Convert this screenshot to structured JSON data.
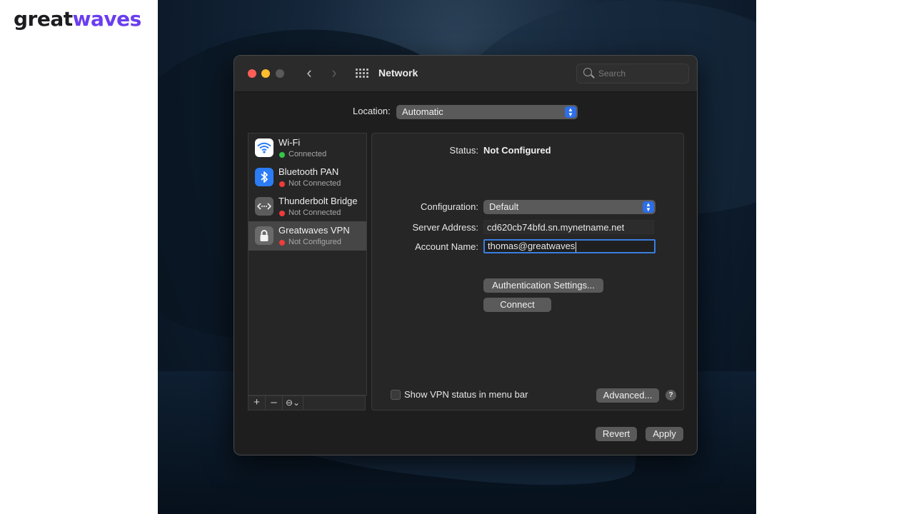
{
  "brand": {
    "part1": "great",
    "part2": "waves"
  },
  "window": {
    "title": "Network",
    "search_placeholder": "Search",
    "location_label": "Location:",
    "location_value": "Automatic"
  },
  "services": [
    {
      "name": "Wi-Fi",
      "status": "Connected",
      "status_color": "#33c748",
      "icon": "wifi-icon"
    },
    {
      "name": "Bluetooth PAN",
      "status": "Not Connected",
      "status_color": "#ef3b3b",
      "icon": "bluetooth-icon"
    },
    {
      "name": "Thunderbolt Bridge",
      "status": "Not Connected",
      "status_color": "#ef3b3b",
      "icon": "thunderbolt-bridge-icon"
    },
    {
      "name": "Greatwaves VPN",
      "status": "Not Configured",
      "status_color": "#ef3b3b",
      "icon": "lock-icon"
    }
  ],
  "sidebar_buttons": {
    "add": "+",
    "remove": "–",
    "action": "⊖⌄"
  },
  "detail": {
    "status_label": "Status:",
    "status_value": "Not Configured",
    "configuration_label": "Configuration:",
    "configuration_value": "Default",
    "server_label": "Server Address:",
    "server_value": "cd620cb74bfd.sn.mynetname.net",
    "account_label": "Account Name:",
    "account_value": "thomas@greatwaves",
    "auth_button": "Authentication Settings...",
    "connect_button": "Connect",
    "show_vpn_label": "Show VPN status in menu bar",
    "advanced_button": "Advanced...",
    "help_button": "?"
  },
  "footer": {
    "revert": "Revert",
    "apply": "Apply"
  },
  "colors": {
    "brand_accent": "#6a3df0",
    "select_accent": "#2d6ee9",
    "focus_ring": "#3a7de0"
  }
}
